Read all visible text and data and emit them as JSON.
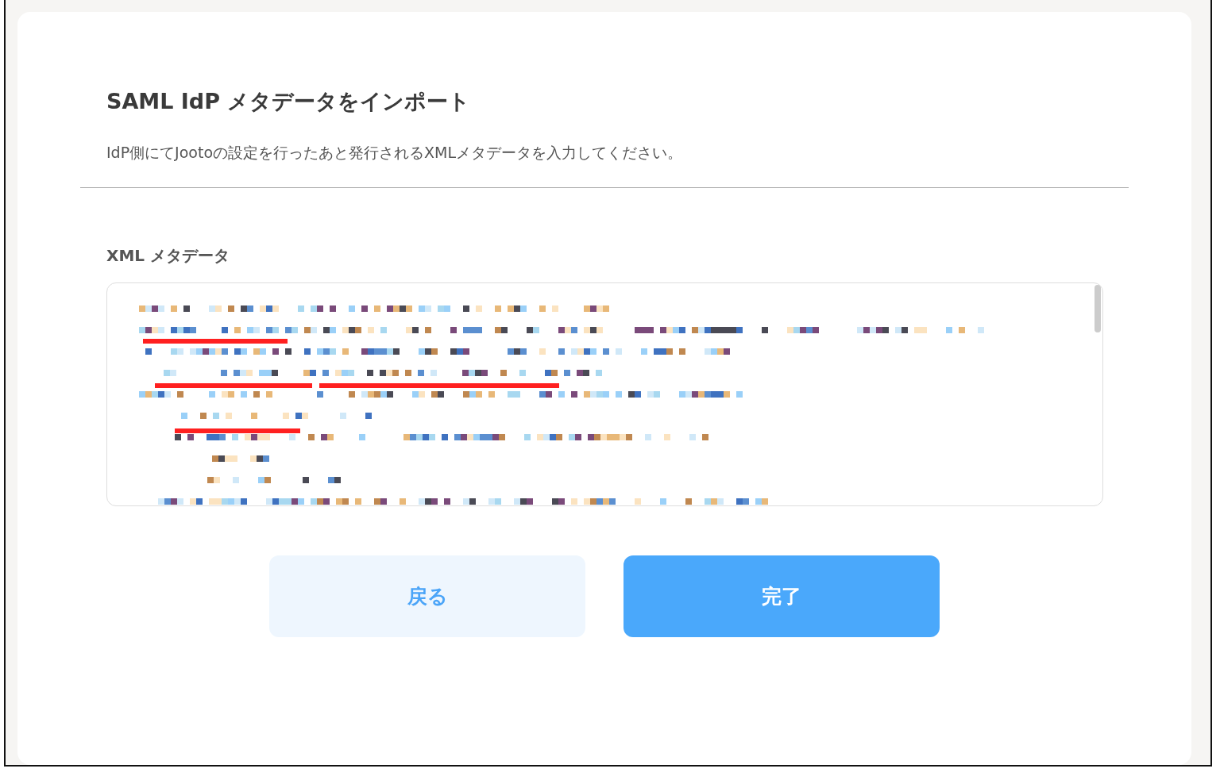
{
  "dialog": {
    "title": "SAML IdP メタデータをインポート",
    "description": "IdP側にてJootoの設定を行ったあと発行されるXMLメタデータを入力してください。"
  },
  "field": {
    "label": "XML メタデータ",
    "kind": "redacted"
  },
  "buttons": [
    {
      "label": "戻る",
      "kind": "secondary"
    },
    {
      "label": "完了",
      "kind": "primary"
    }
  ]
}
